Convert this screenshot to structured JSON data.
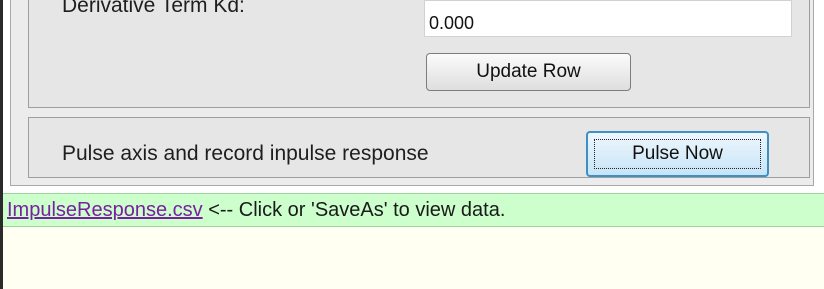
{
  "pid_section": {
    "kd_label": "Derivative Term Kd:",
    "kd_value": "0.000",
    "update_button_label": "Update Row"
  },
  "pulse_section": {
    "description": "Pulse axis and record inpulse response",
    "pulse_button_label": "Pulse Now"
  },
  "download": {
    "link_text": "ImpulseResponse.csv",
    "hint_text": " <-- Click or 'SaveAs' to view data."
  },
  "colors": {
    "panel_bg": "#e6e6e6",
    "link_bar_bg": "#ccffcc",
    "link_color": "#7a1fa3",
    "focus_button_border": "#3e8fc4"
  }
}
